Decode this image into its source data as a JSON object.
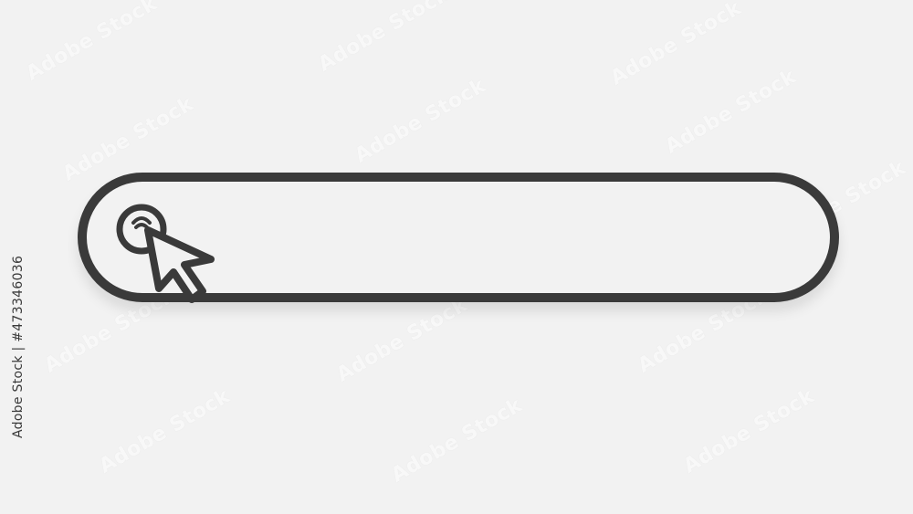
{
  "watermark": {
    "text": "Adobe Stock",
    "side_id": "Adobe Stock | #473346036"
  },
  "search_bar": {
    "value": "",
    "border_color": "#3a3a3a",
    "background_color": "#f2f2f2"
  },
  "icons": {
    "click_cursor": "pointer-click-icon"
  }
}
